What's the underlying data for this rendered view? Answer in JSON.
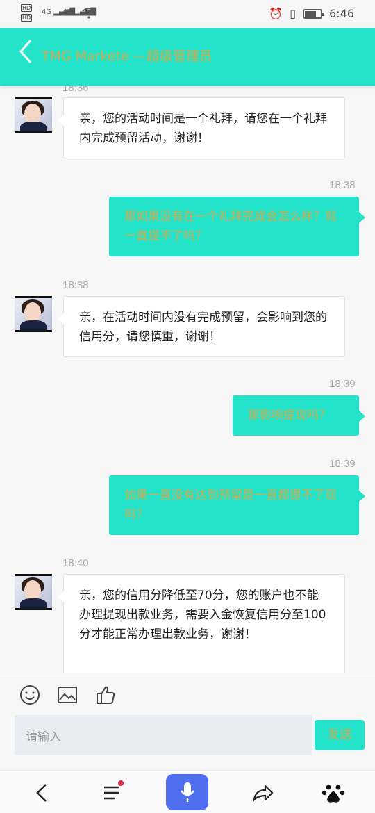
{
  "status_bar": {
    "hd1": "HD",
    "hd2": "HD",
    "net1": "4G",
    "net2": "4G",
    "clock": "6:46"
  },
  "header": {
    "back_icon": "chevron-left-icon",
    "title": "TMG Markete —超级管理员"
  },
  "messages": [
    {
      "side": "in",
      "time": "18:36",
      "text": "亲，您的活动时间是一个礼拜，请您在一个礼拜内完成预留活动，谢谢！"
    },
    {
      "side": "out",
      "time": "18:38",
      "text": "那如果没有在一个礼拜完成会怎么样？就一直提不了吗？"
    },
    {
      "side": "in",
      "time": "18:38",
      "text": "亲，在活动时间内没有完成预留，会影响到您的信用分，请您慎重，谢谢！"
    },
    {
      "side": "out",
      "time": "18:39",
      "text": "那影响提现吗？"
    },
    {
      "side": "out",
      "time": "18:39",
      "text": "如果一直没有达到预留是一直都提不了现吗？"
    },
    {
      "side": "in",
      "time": "18:40",
      "text": "亲，您的信用分降低至70分，您的账户也不能办理提现出款业务，需要入金恢复信用分至100分才能正常办理出款业务，谢谢！"
    }
  ],
  "composer": {
    "tools": [
      "emoji-icon",
      "image-icon",
      "thumbs-up-icon"
    ],
    "placeholder": "请输入",
    "send_label": "发送"
  },
  "nav": {
    "items": [
      "back-icon",
      "menu-icon",
      "mic-icon",
      "share-icon",
      "baidu-paw-icon"
    ]
  },
  "colors": {
    "accent": "#24e3cb",
    "accent_text": "#d6a94a",
    "mic": "#4f6ff0"
  }
}
